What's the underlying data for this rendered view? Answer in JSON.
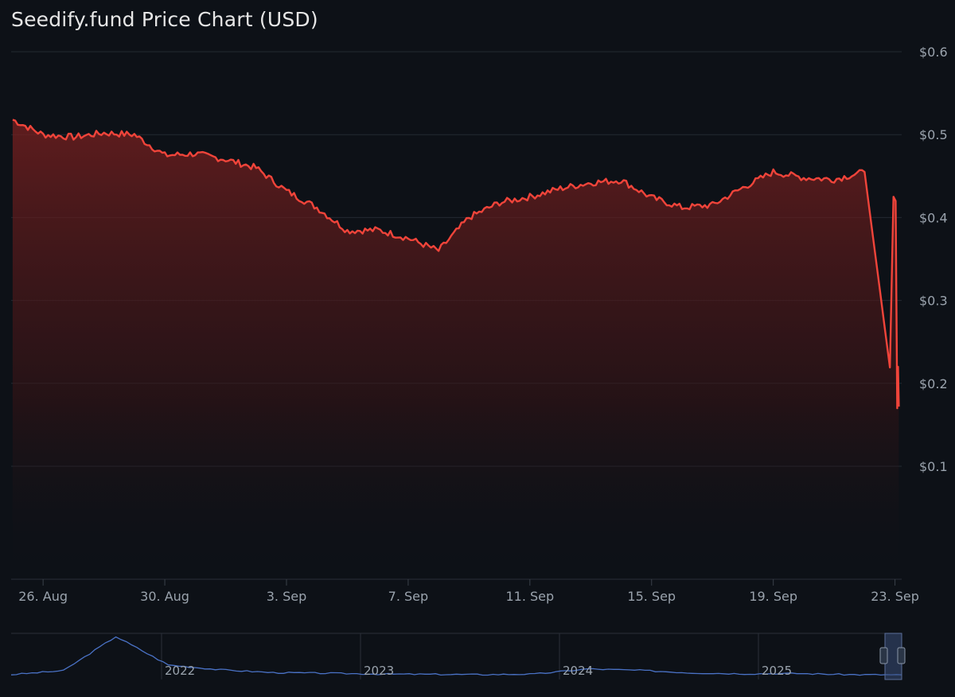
{
  "chart_data": {
    "type": "area",
    "title": "Seedify.fund Price Chart (USD)",
    "currency": "USD",
    "grid": true,
    "legend": "none",
    "colors": {
      "line": "#f0443a",
      "navigator_line": "#4a72c6",
      "background": "#0d1117"
    },
    "y_ticks": [
      "$0.6",
      "$0.5",
      "$0.4",
      "$0.3",
      "$0.2",
      "$0.1"
    ],
    "y_tick_values": [
      0.6,
      0.5,
      0.4,
      0.3,
      0.2,
      0.1
    ],
    "x_ticks": [
      "26. Aug",
      "30. Aug",
      "3. Sep",
      "7. Sep",
      "11. Sep",
      "15. Sep",
      "19. Sep",
      "23. Sep"
    ],
    "x_range": [
      "2025-08-25",
      "2025-09-23"
    ],
    "ylim": [
      0,
      0.63
    ],
    "series": [
      {
        "x": [
          "2025-08-25",
          "2025-08-26",
          "2025-08-27",
          "2025-08-28",
          "2025-08-29",
          "2025-08-30",
          "2025-08-31",
          "2025-09-01",
          "2025-09-02",
          "2025-09-03",
          "2025-09-04",
          "2025-09-05",
          "2025-09-06",
          "2025-09-07",
          "2025-09-08",
          "2025-09-09",
          "2025-09-10",
          "2025-09-11",
          "2025-09-12",
          "2025-09-13",
          "2025-09-14",
          "2025-09-15",
          "2025-09-16",
          "2025-09-17",
          "2025-09-18",
          "2025-09-19",
          "2025-09-20",
          "2025-09-21",
          "2025-09-22",
          "2025-09-23"
        ],
        "values": [
          0.518,
          0.5,
          0.497,
          0.502,
          0.5,
          0.475,
          0.477,
          0.47,
          0.46,
          0.432,
          0.412,
          0.384,
          0.385,
          0.375,
          0.36,
          0.4,
          0.418,
          0.425,
          0.435,
          0.442,
          0.445,
          0.424,
          0.412,
          0.415,
          0.436,
          0.455,
          0.448,
          0.446,
          0.455,
          0.172
        ]
      }
    ],
    "navigator": {
      "labels": [
        "2022",
        "2023",
        "2024",
        "2025"
      ],
      "x": [
        "2021-Q2",
        "2021-Q3",
        "2021-Q4",
        "2022-Q1",
        "2022-Q2",
        "2022-Q3",
        "2022-Q4",
        "2023-Q1",
        "2023-Q2",
        "2023-Q3",
        "2023-Q4",
        "2024-Q1",
        "2024-Q2",
        "2024-Q3",
        "2024-Q4",
        "2025-Q1",
        "2025-Q2",
        "2025-Q3"
      ],
      "values": [
        0.6,
        2.0,
        14.0,
        4.0,
        2.3,
        1.3,
        1.1,
        0.8,
        0.7,
        0.6,
        0.8,
        2.6,
        2.1,
        1.2,
        0.9,
        1.0,
        0.6,
        0.5
      ]
    }
  }
}
